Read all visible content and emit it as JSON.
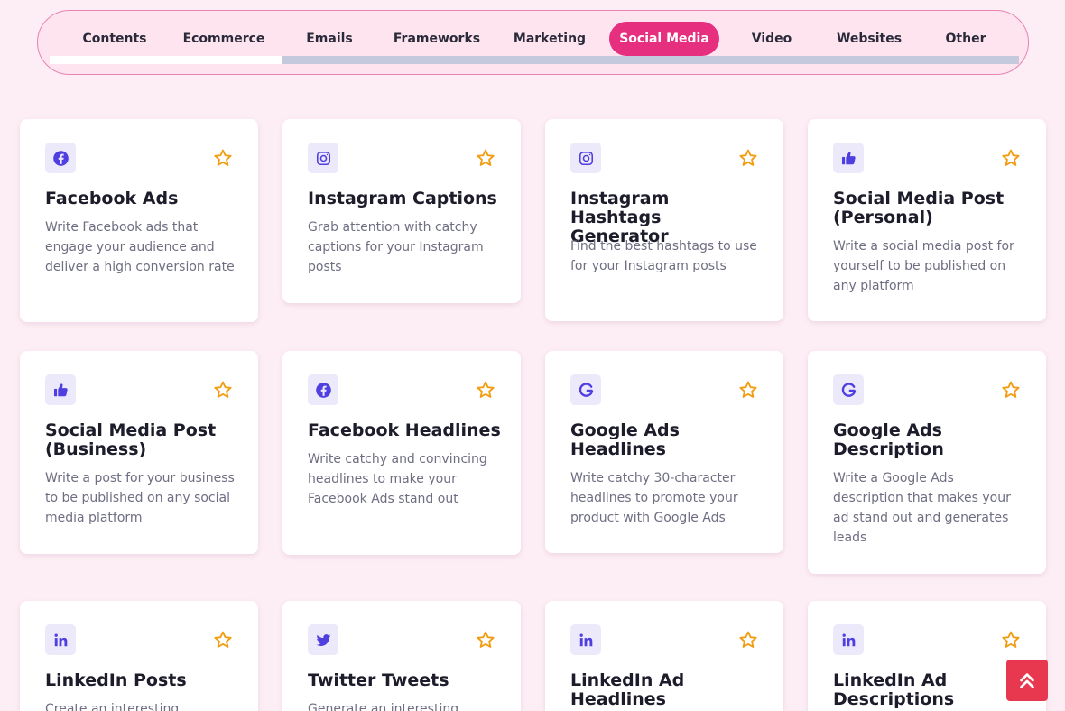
{
  "tabs": [
    {
      "label": "Contents"
    },
    {
      "label": "Ecommerce"
    },
    {
      "label": "Emails"
    },
    {
      "label": "Frameworks"
    },
    {
      "label": "Marketing"
    },
    {
      "label": "Social Media",
      "active": true
    },
    {
      "label": "Video"
    },
    {
      "label": "Websites"
    },
    {
      "label": "Other"
    }
  ],
  "tab_scroll_position": 0.24,
  "colors": {
    "accent": "#e72f7f",
    "icon": "#4f3fe0",
    "star": "#f39c12",
    "scroll_top_button": "#e8384f",
    "background": "#fdeef5"
  },
  "cards": [
    {
      "icon": "facebook-icon",
      "title": "Facebook Ads",
      "description": "Write Facebook ads that engage your audience and deliver a high conversion rate"
    },
    {
      "icon": "instagram-icon",
      "title": "Instagram Captions",
      "description": "Grab attention with catchy captions for your Instagram posts"
    },
    {
      "icon": "instagram-icon",
      "title": "Instagram Hashtags Generator",
      "description": "Find the best hashtags to use for your Instagram posts"
    },
    {
      "icon": "thumbs-up-icon",
      "title": "Social Media Post (Personal)",
      "description": "Write a social media post for yourself to be published on any platform"
    },
    {
      "icon": "thumbs-up-icon",
      "title": "Social Media Post (Business)",
      "description": "Write a post for your business to be published on any social media platform"
    },
    {
      "icon": "facebook-icon",
      "title": "Facebook Headlines",
      "description": "Write catchy and convincing headlines to make your Facebook Ads stand out"
    },
    {
      "icon": "google-icon",
      "title": "Google Ads Headlines",
      "description": "Write catchy 30-character headlines to promote your product with Google Ads"
    },
    {
      "icon": "google-icon",
      "title": "Google Ads Description",
      "description": "Write a Google Ads description that makes your ad stand out and generates leads"
    },
    {
      "icon": "linkedin-icon",
      "title": "LinkedIn Posts",
      "description": "Create an interesting"
    },
    {
      "icon": "twitter-icon",
      "title": "Twitter Tweets",
      "description": "Generate an interesting"
    },
    {
      "icon": "linkedin-icon",
      "title": "LinkedIn Ad Headlines",
      "description": ""
    },
    {
      "icon": "linkedin-icon",
      "title": "LinkedIn Ad Descriptions",
      "description": ""
    }
  ],
  "scroll_top_icon": "double-chevron-up-icon"
}
